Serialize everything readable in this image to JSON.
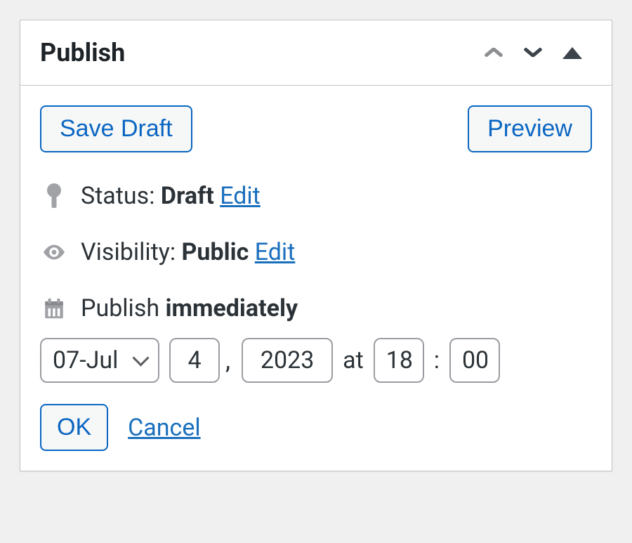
{
  "panel": {
    "title": "Publish"
  },
  "buttons": {
    "save_draft": "Save Draft",
    "preview": "Preview"
  },
  "status": {
    "label": "Status:",
    "value": "Draft",
    "edit": "Edit"
  },
  "visibility": {
    "label": "Visibility:",
    "value": "Public",
    "edit": "Edit"
  },
  "publish": {
    "label": "Publish",
    "mode": "immediately"
  },
  "date": {
    "month": "07-Jul",
    "day": "4",
    "year": "2023",
    "hour": "18",
    "minute": "00",
    "at": "at",
    "comma": ","
  },
  "confirm": {
    "ok": "OK",
    "cancel": "Cancel"
  }
}
